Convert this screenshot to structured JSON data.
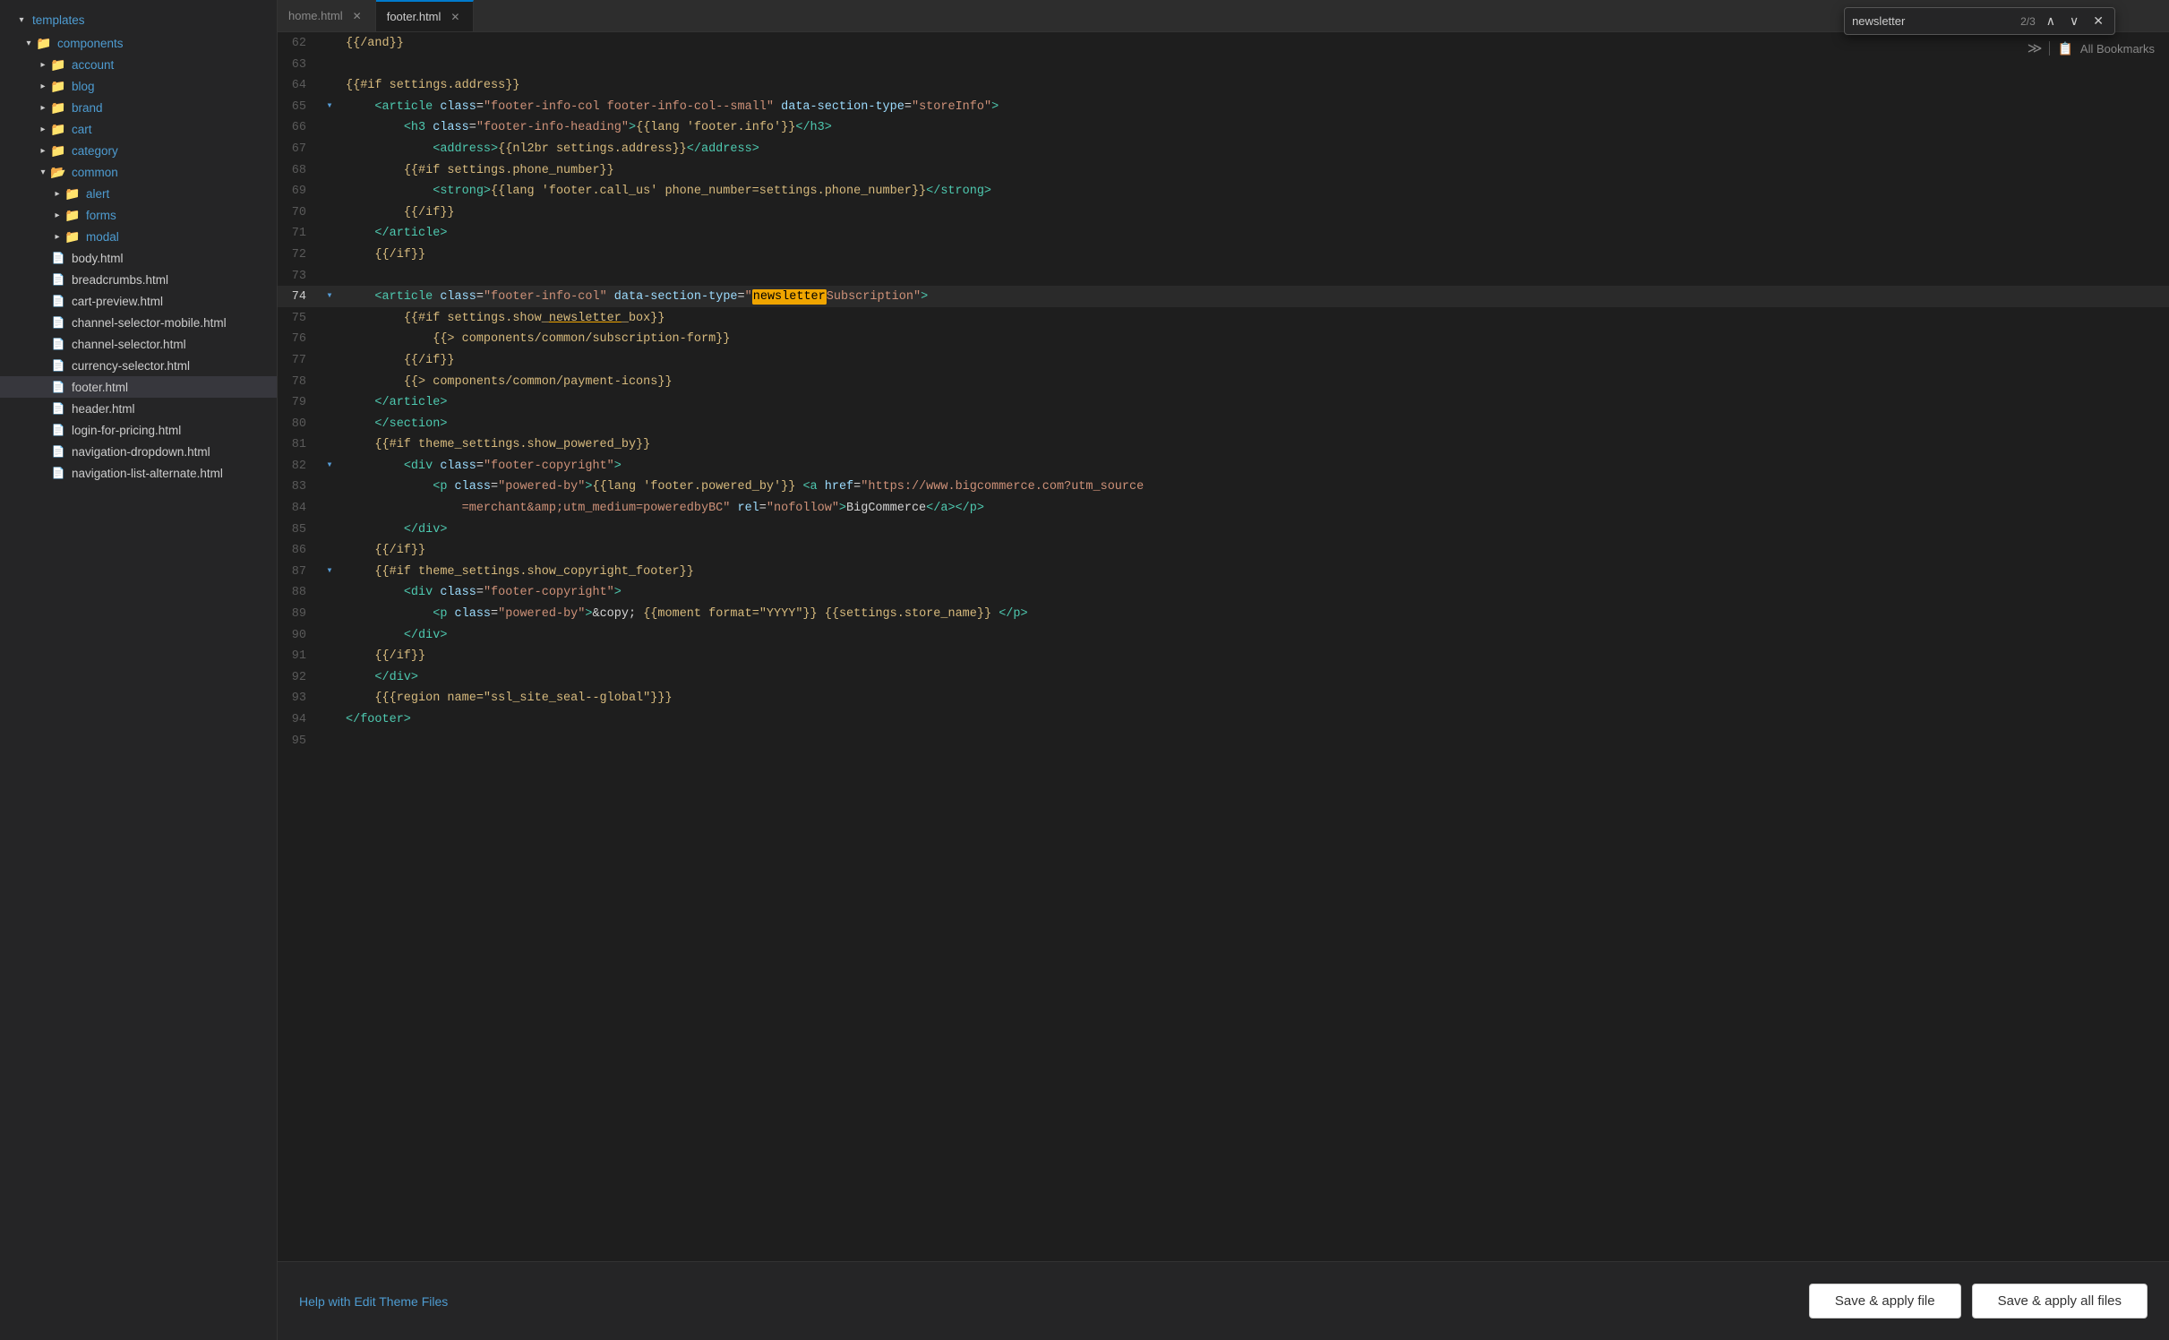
{
  "sidebar": {
    "templates_label": "templates",
    "components_label": "components",
    "items": [
      {
        "id": "account",
        "label": "account",
        "type": "folder",
        "depth": 1,
        "open": false
      },
      {
        "id": "blog",
        "label": "blog",
        "type": "folder",
        "depth": 1,
        "open": false
      },
      {
        "id": "brand",
        "label": "brand",
        "type": "folder",
        "depth": 1,
        "open": false
      },
      {
        "id": "cart",
        "label": "cart",
        "type": "folder",
        "depth": 1,
        "open": false
      },
      {
        "id": "category",
        "label": "category",
        "type": "folder",
        "depth": 1,
        "open": false
      },
      {
        "id": "common",
        "label": "common",
        "type": "folder",
        "depth": 1,
        "open": true
      },
      {
        "id": "alert",
        "label": "alert",
        "type": "folder",
        "depth": 2,
        "open": false
      },
      {
        "id": "forms",
        "label": "forms",
        "type": "folder",
        "depth": 2,
        "open": false
      },
      {
        "id": "modal",
        "label": "modal",
        "type": "folder",
        "depth": 2,
        "open": false
      },
      {
        "id": "body.html",
        "label": "body.html",
        "type": "file",
        "depth": 1
      },
      {
        "id": "breadcrumbs.html",
        "label": "breadcrumbs.html",
        "type": "file",
        "depth": 1
      },
      {
        "id": "cart-preview.html",
        "label": "cart-preview.html",
        "type": "file",
        "depth": 1
      },
      {
        "id": "channel-selector-mobile.html",
        "label": "channel-selector-mobile.html",
        "type": "file",
        "depth": 1
      },
      {
        "id": "channel-selector.html",
        "label": "channel-selector.html",
        "type": "file",
        "depth": 1
      },
      {
        "id": "currency-selector.html",
        "label": "currency-selector.html",
        "type": "file",
        "depth": 1
      },
      {
        "id": "footer.html",
        "label": "footer.html",
        "type": "file",
        "depth": 1,
        "selected": true
      },
      {
        "id": "header.html",
        "label": "header.html",
        "type": "file",
        "depth": 1
      },
      {
        "id": "login-for-pricing.html",
        "label": "login-for-pricing.html",
        "type": "file",
        "depth": 1
      },
      {
        "id": "navigation-dropdown.html",
        "label": "navigation-dropdown.html",
        "type": "file",
        "depth": 1
      },
      {
        "id": "navigation-list-alternate.html",
        "label": "navigation-list-alternate.html",
        "type": "file",
        "depth": 1
      }
    ]
  },
  "tabs": [
    {
      "id": "home.html",
      "label": "home.html",
      "active": false
    },
    {
      "id": "footer.html",
      "label": "footer.html",
      "active": true
    }
  ],
  "search": {
    "value": "newsletter",
    "count": "2/3",
    "up_title": "Previous match",
    "down_title": "Next match",
    "close_title": "Close"
  },
  "bookmarks": {
    "label": "All Bookmarks"
  },
  "code_lines": [
    {
      "num": 62,
      "gutter": "",
      "content": "{{/and}}"
    },
    {
      "num": 63,
      "gutter": "",
      "content": ""
    },
    {
      "num": 64,
      "gutter": "",
      "content": "{{#if settings.address}}"
    },
    {
      "num": 65,
      "gutter": "▾",
      "content": "<article class=\"footer-info-col footer-info-col--small\" data-section-type=\"storeInfo\">"
    },
    {
      "num": 66,
      "gutter": "",
      "content": "    <h3 class=\"footer-info-heading\">{{lang 'footer.info'}}</h3>"
    },
    {
      "num": 67,
      "gutter": "",
      "content": "        <address>{{nl2br settings.address}}</address>"
    },
    {
      "num": 68,
      "gutter": "",
      "content": "        {{#if settings.phone_number}}"
    },
    {
      "num": 69,
      "gutter": "",
      "content": "            <strong>{{lang 'footer.call_us' phone_number=settings.phone_number}}</strong>"
    },
    {
      "num": 70,
      "gutter": "",
      "content": "        {{/if}}"
    },
    {
      "num": 71,
      "gutter": "",
      "content": "    </article>"
    },
    {
      "num": 72,
      "gutter": "",
      "content": "    {{/if}}"
    },
    {
      "num": 73,
      "gutter": "",
      "content": ""
    },
    {
      "num": 74,
      "gutter": "▾",
      "content": "    <article class=\"footer-info-col\" data-section-type=\"newsletterSubscription\">"
    },
    {
      "num": 75,
      "gutter": "",
      "content": "        {{#if settings.show_newsletter_box}}"
    },
    {
      "num": 76,
      "gutter": "",
      "content": "            {{> components/common/subscription-form}}"
    },
    {
      "num": 77,
      "gutter": "",
      "content": "        {{/if}}"
    },
    {
      "num": 78,
      "gutter": "",
      "content": "        {{> components/common/payment-icons}}"
    },
    {
      "num": 79,
      "gutter": "",
      "content": "    </article>"
    },
    {
      "num": 80,
      "gutter": "",
      "content": "    </section>"
    },
    {
      "num": 81,
      "gutter": "",
      "content": "    {{#if theme_settings.show_powered_by}}"
    },
    {
      "num": 82,
      "gutter": "▾",
      "content": "        <div class=\"footer-copyright\">"
    },
    {
      "num": 83,
      "gutter": "",
      "content": "            <p class=\"powered-by\">{{lang 'footer.powered_by'}} <a href=\"https://www.bigcommerce.com?utm_source"
    },
    {
      "num": 84,
      "gutter": "",
      "content": "                =merchant&amp;utm_medium=poweredbyBC\" rel=\"nofollow\">BigCommerce</a></p>"
    },
    {
      "num": 85,
      "gutter": "",
      "content": "        </div>"
    },
    {
      "num": 86,
      "gutter": "",
      "content": "    {{/if}}"
    },
    {
      "num": 87,
      "gutter": "▾",
      "content": "    {{#if theme_settings.show_copyright_footer}}"
    },
    {
      "num": 88,
      "gutter": "",
      "content": "        <div class=\"footer-copyright\">"
    },
    {
      "num": 89,
      "gutter": "",
      "content": "            <p class=\"powered-by\">&copy; {{moment format=\"YYYY\"}} {{settings.store_name}} </p>"
    },
    {
      "num": 90,
      "gutter": "",
      "content": "        </div>"
    },
    {
      "num": 91,
      "gutter": "",
      "content": "    {{/if}}"
    },
    {
      "num": 92,
      "gutter": "",
      "content": "    </div>"
    },
    {
      "num": 93,
      "gutter": "",
      "content": "    {{{region name=\"ssl_site_seal--global\"}}}"
    },
    {
      "num": 94,
      "gutter": "",
      "content": "</footer>"
    },
    {
      "num": 95,
      "gutter": "",
      "content": ""
    }
  ],
  "footer": {
    "help_text": "Help with Edit Theme Files",
    "save_file_label": "Save & apply file",
    "save_all_label": "Save & apply all files"
  }
}
